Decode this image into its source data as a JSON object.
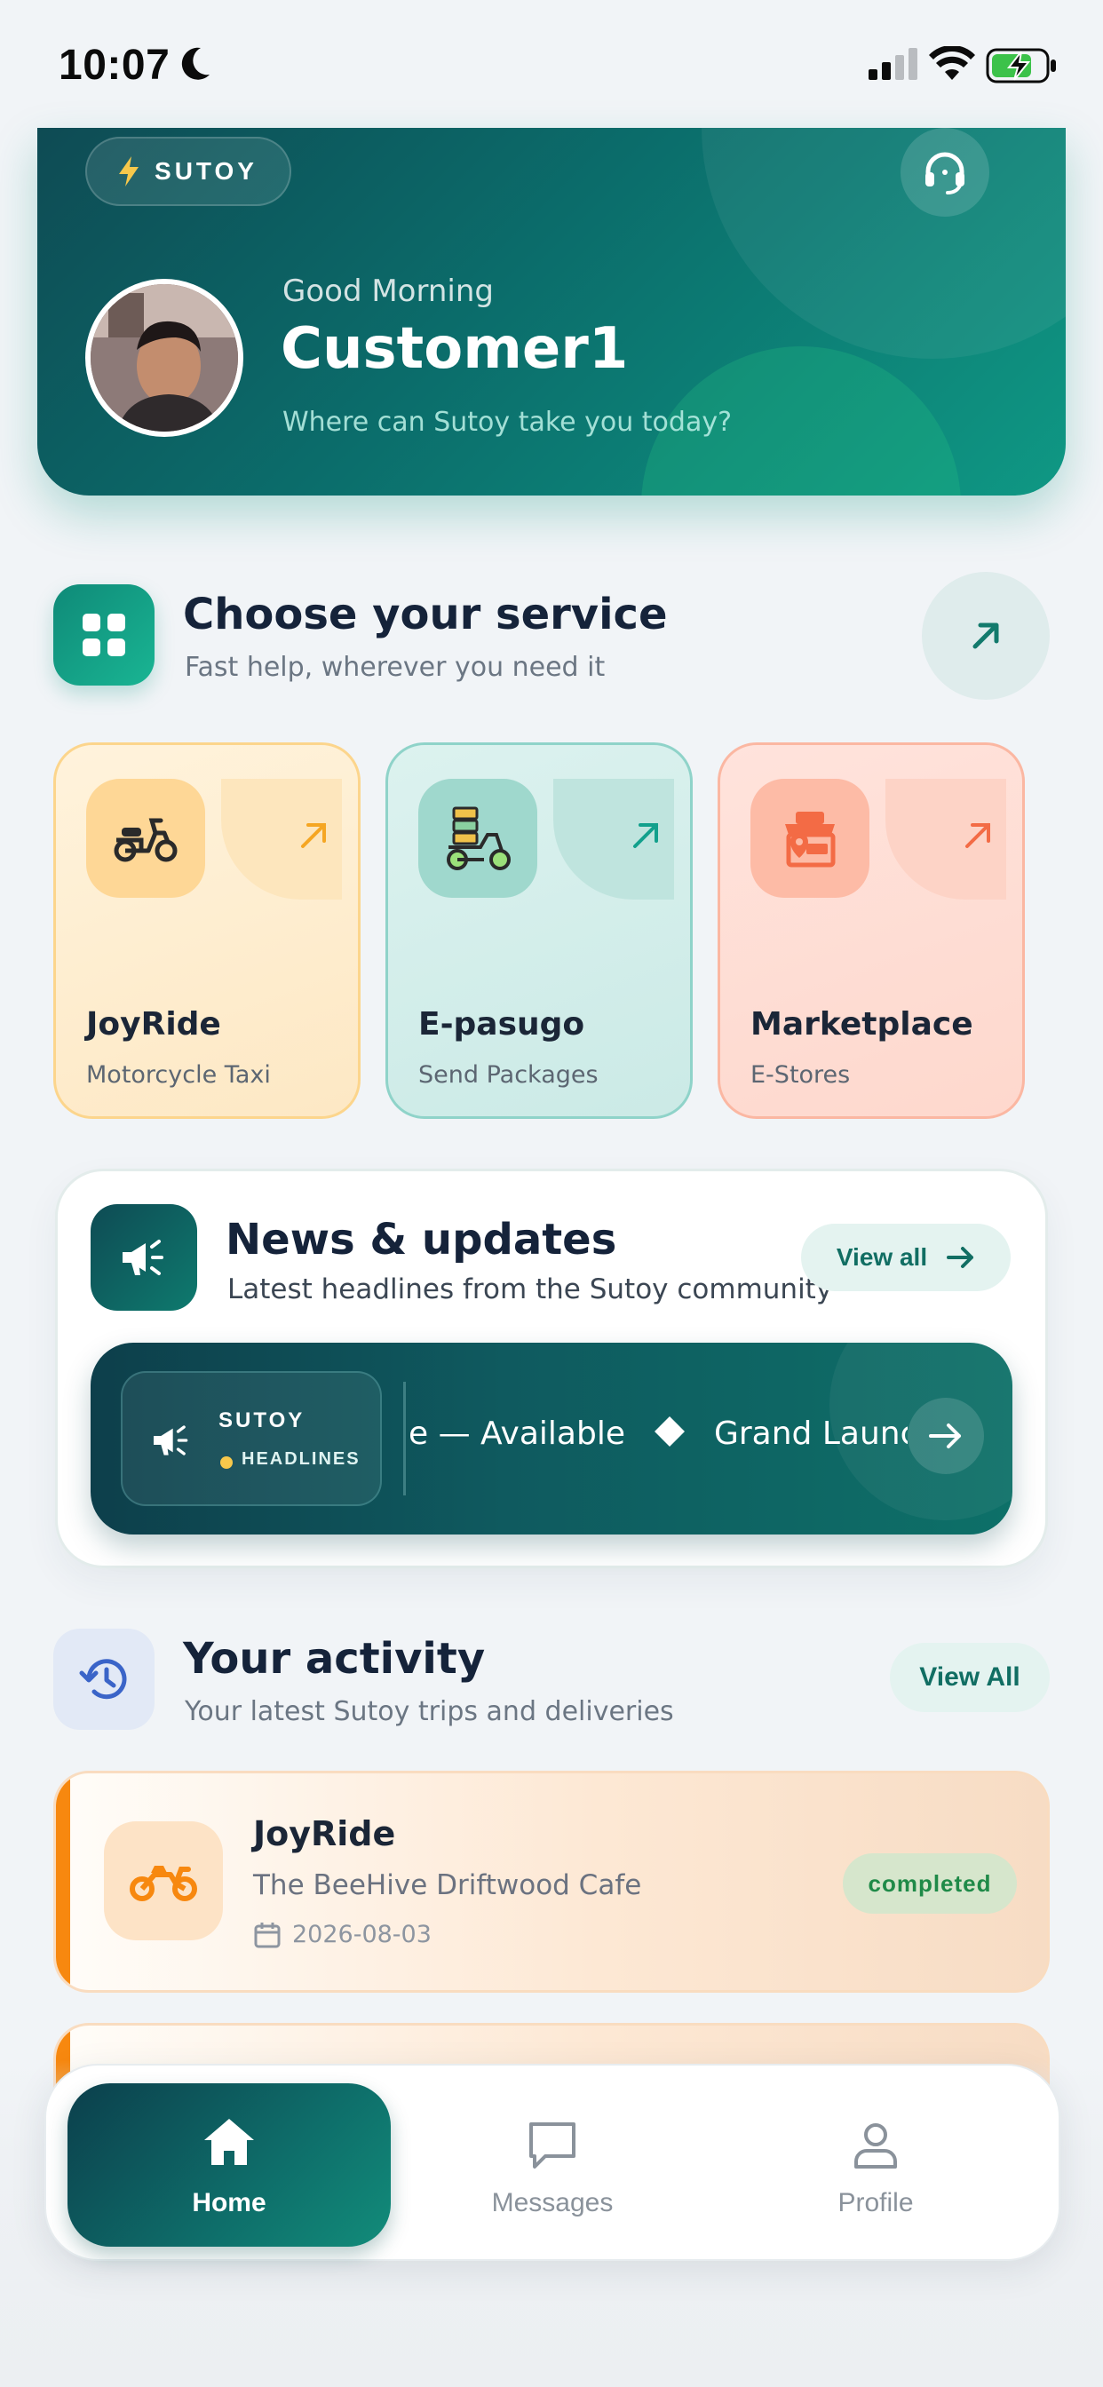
{
  "status_bar": {
    "time": "10:07"
  },
  "hero": {
    "brand": "SUTOY",
    "greeting": "Good Morning",
    "user_name": "Customer1",
    "subtitle": "Where can Sutoy take you today?"
  },
  "services": {
    "title": "Choose your service",
    "subtitle": "Fast help, wherever you need it",
    "items": [
      {
        "name": "JoyRide",
        "desc": "Motorcycle Taxi",
        "accent": "#f5a623"
      },
      {
        "name": "E-pasugo",
        "desc": "Send Packages",
        "accent": "#12a08c"
      },
      {
        "name": "Marketplace",
        "desc": "E-Stores",
        "accent": "#f36b45"
      }
    ]
  },
  "news": {
    "title": "News & updates",
    "subtitle": "Latest headlines from the Sutoy community",
    "view_all": "View all",
    "ticker": {
      "brand": "SUTOY",
      "label": "HEADLINES",
      "item1": "e — Available",
      "item2": "Grand Launch"
    }
  },
  "activity": {
    "title": "Your activity",
    "subtitle": "Your latest Sutoy trips and deliveries",
    "view_all": "View All",
    "items": [
      {
        "service": "JoyRide",
        "place": "The BeeHive Driftwood Cafe",
        "date": "2026-08-03",
        "status": "completed"
      }
    ]
  },
  "nav": {
    "home": "Home",
    "messages": "Messages",
    "profile": "Profile"
  },
  "colors": {
    "brand_teal": "#0e6e6a",
    "brand_dark": "#0d3f4b",
    "joyride_orange": "#f7880f",
    "completed_green": "#1f8a48"
  }
}
